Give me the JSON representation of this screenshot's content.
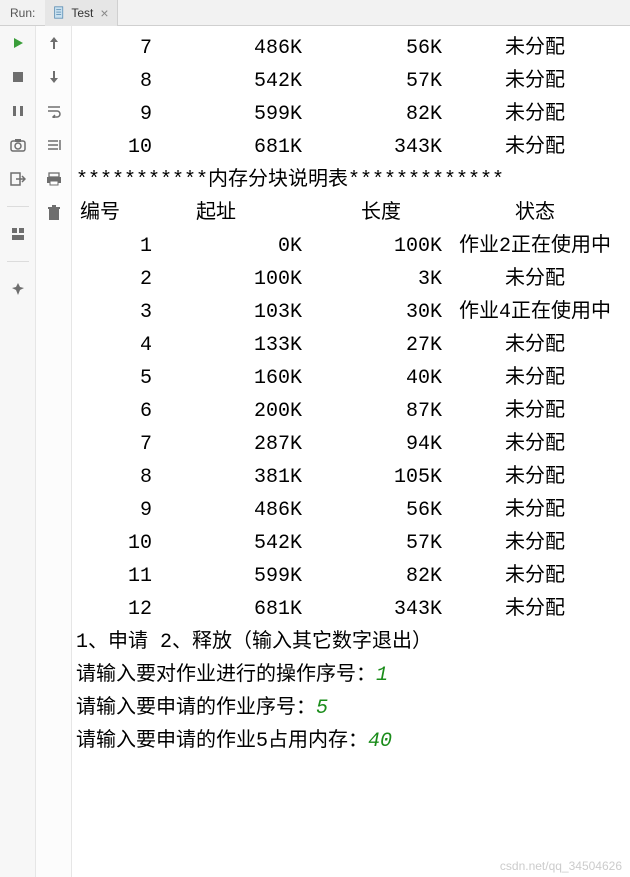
{
  "header": {
    "run_label": "Run:",
    "tab_label": "Test"
  },
  "top_rows": [
    {
      "id": "7",
      "addr": "486K",
      "len": "56K",
      "status": "未分配"
    },
    {
      "id": "8",
      "addr": "542K",
      "len": "57K",
      "status": "未分配"
    },
    {
      "id": "9",
      "addr": "599K",
      "len": "82K",
      "status": "未分配"
    },
    {
      "id": "10",
      "addr": "681K",
      "len": "343K",
      "status": "未分配"
    }
  ],
  "banner": "***********内存分块说明表*************",
  "columns": {
    "id": "编号",
    "addr": "起址",
    "len": "长度",
    "status": "状态"
  },
  "main_rows": [
    {
      "id": "1",
      "addr": "0K",
      "len": "100K",
      "status": "作业2正在使用中"
    },
    {
      "id": "2",
      "addr": "100K",
      "len": "3K",
      "status": "未分配"
    },
    {
      "id": "3",
      "addr": "103K",
      "len": "30K",
      "status": "作业4正在使用中"
    },
    {
      "id": "4",
      "addr": "133K",
      "len": "27K",
      "status": "未分配"
    },
    {
      "id": "5",
      "addr": "160K",
      "len": "40K",
      "status": "未分配"
    },
    {
      "id": "6",
      "addr": "200K",
      "len": "87K",
      "status": "未分配"
    },
    {
      "id": "7",
      "addr": "287K",
      "len": "94K",
      "status": "未分配"
    },
    {
      "id": "8",
      "addr": "381K",
      "len": "105K",
      "status": "未分配"
    },
    {
      "id": "9",
      "addr": "486K",
      "len": "56K",
      "status": "未分配"
    },
    {
      "id": "10",
      "addr": "542K",
      "len": "57K",
      "status": "未分配"
    },
    {
      "id": "11",
      "addr": "599K",
      "len": "82K",
      "status": "未分配"
    },
    {
      "id": "12",
      "addr": "681K",
      "len": "343K",
      "status": "未分配"
    }
  ],
  "prompts": {
    "menu": "1、申请 2、释放（输入其它数字退出）",
    "p1": "请输入要对作业进行的操作序号：",
    "a1": "1",
    "p2": "请输入要申请的作业序号：",
    "a2": "5",
    "p3": "请输入要申请的作业5占用内存：",
    "a3": "40"
  },
  "watermark": "csdn.net/qq_34504626"
}
